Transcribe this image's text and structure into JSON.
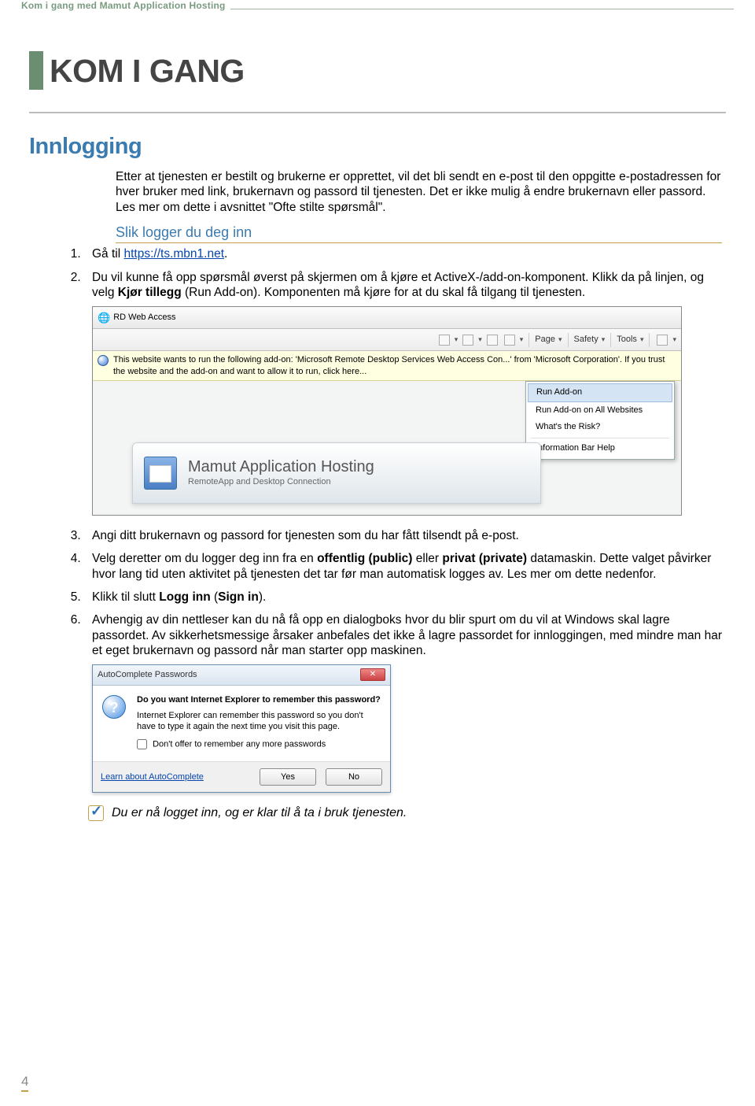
{
  "header": "Kom i gang med Mamut Application Hosting",
  "title": "KOM I GANG",
  "section": "Innlogging",
  "intro1": "Etter at tjenesten er bestilt og brukerne er opprettet, vil det bli sendt en e-post til den oppgitte e-postadressen for hver bruker med link, brukernavn og passord til tjenesten. Det er ikke mulig å endre brukernavn eller passord. Les mer om dette i avsnittet \"Ofte stilte spørsmål\".",
  "sub": "Slik logger du deg inn",
  "steps": {
    "s1_pre": "Gå til ",
    "s1_link": "https://ts.mbn1.net",
    "s1_post": ".",
    "s2_a": "Du vil kunne få opp spørsmål øverst på skjermen om å kjøre et ActiveX-/add-on-komponent. Klikk da på linjen, og velg ",
    "s2_b": "Kjør tillegg",
    "s2_c": " (Run Add-on). Komponenten må kjøre for at du skal få tilgang til tjenesten.",
    "s3": "Angi ditt brukernavn og passord for tjenesten som du har fått tilsendt på e-post.",
    "s4_a": "Velg deretter om du logger deg inn fra en ",
    "s4_b": "offentlig (public)",
    "s4_c": " eller ",
    "s4_d": "privat (private)",
    "s4_e": " datamaskin. Dette valget påvirker hvor lang tid uten aktivitet på tjenesten det tar før man automatisk logges av. Les mer om dette nedenfor.",
    "s5_a": "Klikk til slutt ",
    "s5_b": "Logg inn",
    "s5_c": " (",
    "s5_d": "Sign in",
    "s5_e": ").",
    "s6": "Avhengig av din nettleser kan du nå få opp en dialogboks hvor du blir spurt om du vil at Windows skal lagre passordet. Av sikkerhetsmessige årsaker anbefales det ikke å lagre passordet for innloggingen, med mindre man har et eget brukernavn og passord når man starter opp maskinen."
  },
  "ss1": {
    "tab": "RD Web Access",
    "toolbar": {
      "page": "Page",
      "safety": "Safety",
      "tools": "Tools"
    },
    "infobar": "This website wants to run the following add-on: 'Microsoft Remote Desktop Services Web Access Con...' from 'Microsoft Corporation'. If you trust the website and the add-on and want to allow it to run, click here...",
    "menu": {
      "m1": "Run Add-on",
      "m2": "Run Add-on on All Websites",
      "m3": "What's the Risk?",
      "m4": "Information Bar Help"
    },
    "banner_title": "Mamut Application Hosting",
    "banner_sub": "RemoteApp and Desktop Connection"
  },
  "ss2": {
    "title": "AutoComplete Passwords",
    "q1": "Do you want Internet Explorer to remember this password?",
    "q2": "Internet Explorer can remember this password so you don't have to type it again the next time you visit this page.",
    "chk": "Don't offer to remember any more passwords",
    "link": "Learn about AutoComplete",
    "yes": "Yes",
    "no": "No"
  },
  "footnote": "Du er nå logget inn, og er klar til å ta i bruk tjenesten.",
  "page": "4"
}
